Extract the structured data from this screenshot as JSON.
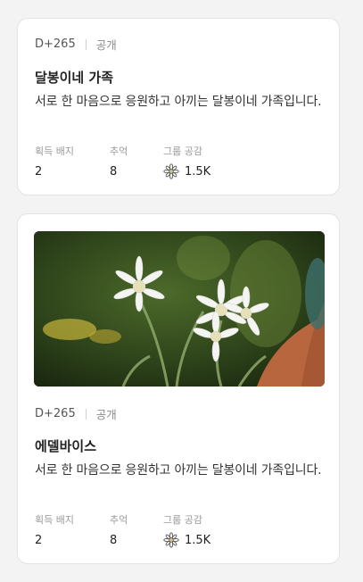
{
  "cards": [
    {
      "d_day": "D+265",
      "visibility": "공개",
      "title": "달봉이네 가족",
      "description": "서로 한 마음으로 응원하고 아끼는 달봉이네 가족입니다.",
      "stats": {
        "badge_label": "획득 배지",
        "badge_value": "2",
        "memory_label": "추억",
        "memory_value": "8",
        "empathy_label": "그룹 공감",
        "empathy_value": "1.5K"
      }
    },
    {
      "photo_alt": "edelweiss-photo",
      "d_day": "D+265",
      "visibility": "공개",
      "title": "에델바이스",
      "description": "서로 한 마음으로 응원하고 아끼는 달봉이네 가족입니다.",
      "stats": {
        "badge_label": "획득 배지",
        "badge_value": "2",
        "memory_label": "추억",
        "memory_value": "8",
        "empathy_label": "그룹 공감",
        "empathy_value": "1.5K"
      }
    }
  ],
  "icons": {
    "empathy": "edelweiss-flower-icon"
  },
  "colors": {
    "background": "#f3f3f3",
    "card": "#ffffff",
    "border": "#e3e3e3",
    "muted_text": "#9a9a9a"
  }
}
